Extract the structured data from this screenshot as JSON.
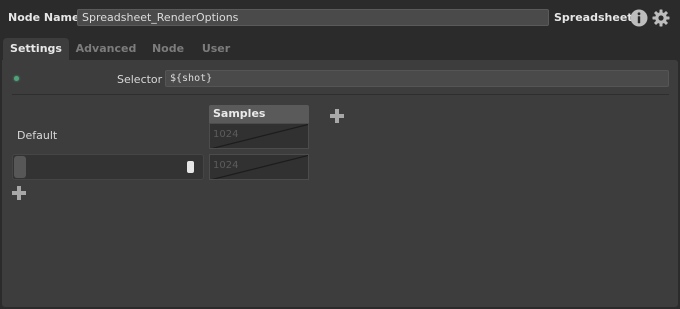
{
  "header": {
    "node_name_label": "Node Name",
    "node_name_value": "Spreadsheet_RenderOptions",
    "node_type": "Spreadsheet",
    "icons": [
      "info-icon",
      "gear-icon"
    ]
  },
  "tabs": [
    {
      "label": "Settings",
      "active": true
    },
    {
      "label": "Advanced",
      "active": false
    },
    {
      "label": "Node",
      "active": false
    },
    {
      "label": "User",
      "active": false
    }
  ],
  "settings": {
    "selector_label": "Selector",
    "selector_value": "${shot}",
    "columns": [
      {
        "header": "Samples"
      }
    ],
    "default_row_label": "Default",
    "default_values": [
      "1024"
    ],
    "rows": [
      {
        "values": [
          "1024"
        ]
      }
    ]
  },
  "colors": {
    "indicator_green": "#4fa37a",
    "panel_bg": "#3d3d3d",
    "window_bg": "#2b2b2b"
  }
}
